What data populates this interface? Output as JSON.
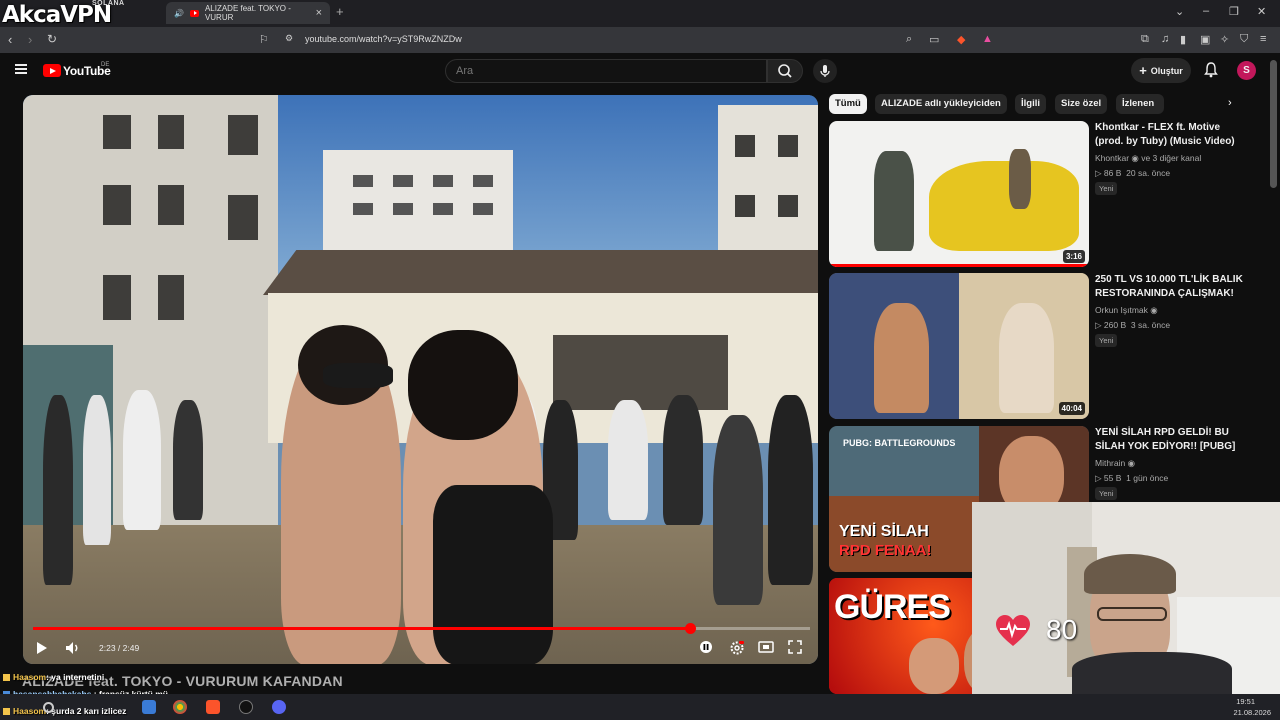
{
  "overlay": {
    "logo_text": "AkcaVPN",
    "logo_sub": "SOLANA",
    "now_playing": "ALIZADE feat. TOKYO - VURURUM KAFANDAN",
    "chat": [
      {
        "user": "Haasom",
        "text": "ya internetini"
      },
      {
        "user": "hasansabbahakahs",
        "text": "fransüz kürtü mü"
      },
      {
        "user": "Haasom",
        "text": "şurda 2 karı izlicez"
      }
    ],
    "heart_rate": "80"
  },
  "browser": {
    "tab_title": "ALIZADE feat. TOKYO - VURUR",
    "url": "youtube.com/watch?v=yST9RwZNZDw",
    "new_tab_label": "+",
    "badges": {
      "brave_count": "79"
    }
  },
  "youtube": {
    "brand": "YouTube",
    "country": "DE",
    "search_placeholder": "Ara",
    "create_label": "Oluştur",
    "avatar_letter": "S"
  },
  "player": {
    "time_current": "2:23",
    "time_total": "2:49",
    "time_display": "2:23 / 2:49",
    "progress_fraction": 0.846
  },
  "chips": [
    {
      "label": "Tümü",
      "active": true
    },
    {
      "label": "ALIZADE adlı yükleyiciden",
      "active": false
    },
    {
      "label": "İlgili",
      "active": false
    },
    {
      "label": "Size özel",
      "active": false
    },
    {
      "label": "İzlenen",
      "active": false
    }
  ],
  "recommendations": [
    {
      "title": "Khontkar - FLEX ft. Motive (prod. by Tuby) (Music Video)",
      "channel": "Khontkar",
      "channel_extra": "ve 3 diğer kanal",
      "views": "86 B",
      "age": "20 sa. önce",
      "badge": "Yeni",
      "duration": "3:16"
    },
    {
      "title": "250 TL VS 10.000 TL'LİK BALIK RESTORANINDA ÇALIŞMAK!",
      "channel": "Orkun Işıtmak",
      "channel_extra": "",
      "views": "260 B",
      "age": "3 sa. önce",
      "badge": "Yeni",
      "duration": "40:04"
    },
    {
      "title": "YENİ SİLAH RPD GELDİ! BU SİLAH YOK EDİYOR!! [PUBG]",
      "channel": "Mithrain",
      "channel_extra": "",
      "views": "55 B",
      "age": "1 gün önce",
      "badge": "Yeni",
      "duration": ""
    },
    {
      "title": "",
      "channel": "",
      "channel_extra": "",
      "views": "",
      "age": "",
      "badge": "",
      "duration": ""
    }
  ],
  "thumb_text": {
    "pubg_brand": "PUBG: BATTLEGROUNDS",
    "pubg_line1": "YENİ SİLAH",
    "pubg_line2": "RPD FENAA!",
    "gures": "GÜRES"
  },
  "taskbar": {
    "time": "19:51",
    "date": "21.08.2026"
  },
  "colors": {
    "accent": "#ff0000",
    "bg": "#0f0f0f",
    "chip_bg": "#272727"
  }
}
